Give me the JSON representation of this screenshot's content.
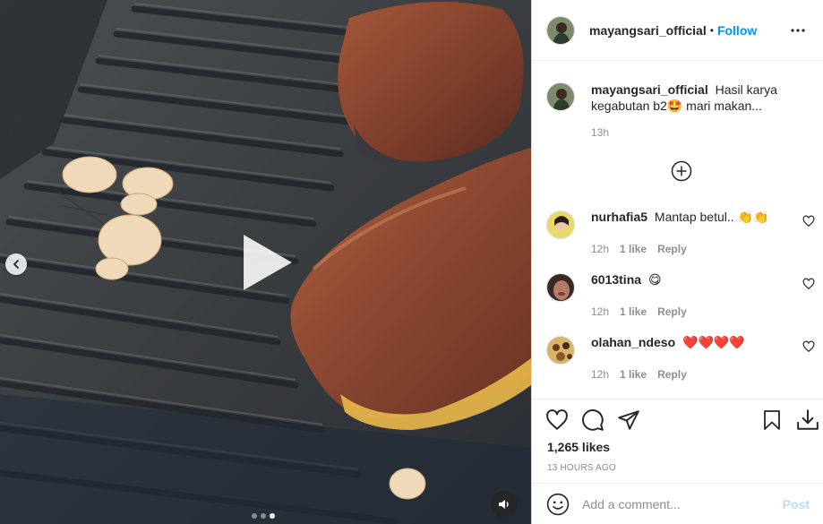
{
  "post": {
    "author": "mayangsari_official",
    "separator": "•",
    "follow_label": "Follow",
    "caption_text": "Hasil karya kegabutan b2🤩 mari makan...",
    "caption_time": "13h"
  },
  "comments": [
    {
      "user": "nurhafia5",
      "text": "Mantap betul.. 👏👏",
      "time": "12h",
      "likes": "1 like",
      "reply": "Reply"
    },
    {
      "user": "6013tina",
      "text": "😋",
      "time": "12h",
      "likes": "1 like",
      "reply": "Reply"
    },
    {
      "user": "olahan_ndeso",
      "text": "❤️❤️❤️❤️",
      "time": "12h",
      "likes": "1 like",
      "reply": "Reply"
    }
  ],
  "stats": {
    "likes": "1,265 likes",
    "posted": "13 HOURS AGO"
  },
  "composer": {
    "placeholder": "Add a comment...",
    "post_label": "Post"
  },
  "media": {
    "slide_count": 3,
    "active_slide": 3
  },
  "colors": {
    "accent": "#0095f6",
    "post_disabled": "#b2dffc",
    "secondary_text": "#8e8e8e",
    "like_red": "#ed4956"
  },
  "icons": [
    "chevron-left-icon",
    "play-icon",
    "speaker-icon",
    "more-icon",
    "plus-circle-icon",
    "heart-icon",
    "comment-icon",
    "share-icon",
    "bookmark-icon",
    "download-icon",
    "emoji-icon"
  ]
}
